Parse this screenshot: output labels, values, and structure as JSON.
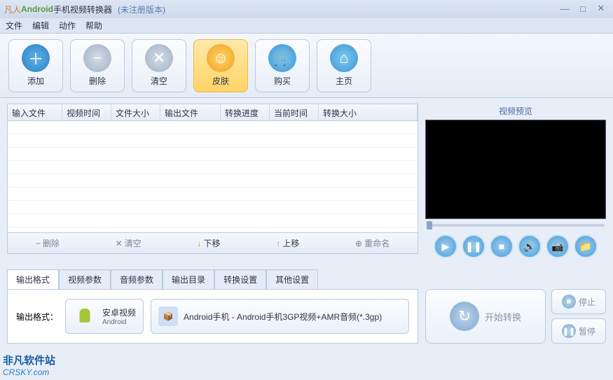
{
  "title": {
    "brand": "凡人",
    "android": "Android",
    "rest": "手机视频转换器",
    "reg": "(未注册版本)"
  },
  "menu": {
    "file": "文件",
    "edit": "编辑",
    "action": "动作",
    "help": "帮助"
  },
  "toolbar": {
    "add": "添加",
    "delete": "删除",
    "clear": "清空",
    "skin": "皮肤",
    "buy": "购买",
    "home": "主页"
  },
  "table": {
    "headers": [
      "输入文件",
      "视频时间",
      "文件大小",
      "输出文件",
      "转换进度",
      "当前时间",
      "转换大小"
    ]
  },
  "list_actions": {
    "delete": "删除",
    "clear": "清空",
    "down": "下移",
    "up": "上移",
    "rename": "重命名"
  },
  "preview": {
    "title": "视频预览"
  },
  "tabs": [
    "输出格式",
    "视频参数",
    "音频参数",
    "输出目录",
    "转换设置",
    "其他设置"
  ],
  "output": {
    "label": "输出格式：",
    "platform": "安卓视频",
    "platform_sub": "Android",
    "format": "Android手机 - Android手机3GP视频+AMR音频(*.3gp)"
  },
  "actions": {
    "start": "开始转换",
    "stop": "停止",
    "pause": "暂停"
  },
  "watermark": {
    "cn": "非凡软件站",
    "url": "CRSKY.com"
  }
}
